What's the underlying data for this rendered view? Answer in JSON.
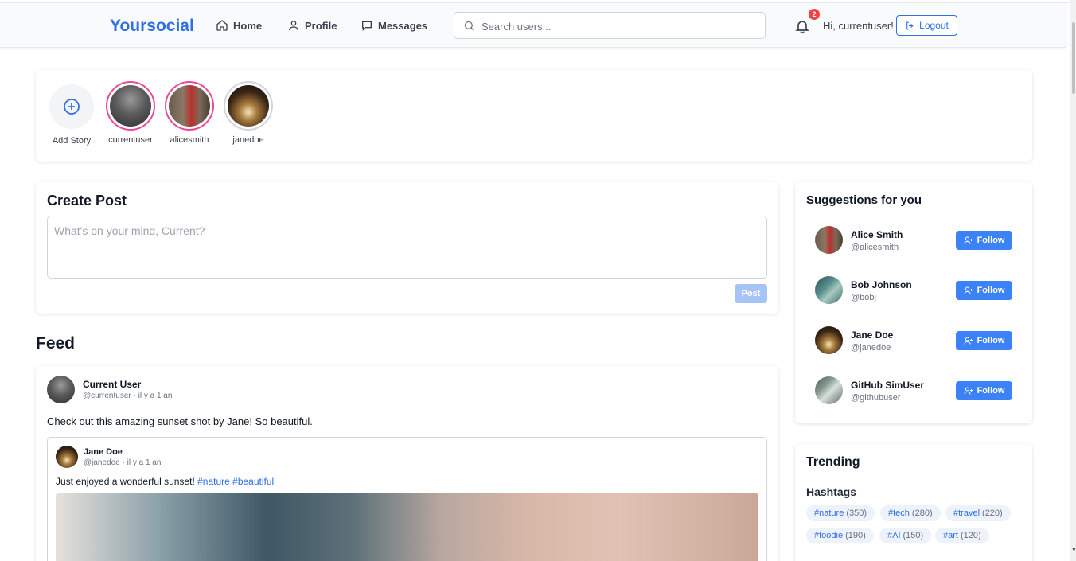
{
  "nav": {
    "brand": "Yoursocial",
    "home": "Home",
    "profile": "Profile",
    "messages": "Messages",
    "search_placeholder": "Search users...",
    "notification_count": "2",
    "greeting": "Hi, currentuser!",
    "logout": "Logout"
  },
  "stories": {
    "add_label": "Add Story",
    "items": [
      {
        "label": "currentuser"
      },
      {
        "label": "alicesmith"
      },
      {
        "label": "janedoe"
      }
    ]
  },
  "create_post": {
    "title": "Create Post",
    "placeholder": "What's on your mind, Current?",
    "button": "Post"
  },
  "feed": {
    "title": "Feed",
    "post": {
      "author": "Current User",
      "meta": "@currentuser · il y a 1 an",
      "text": "Check out this amazing sunset shot by Jane! So beautiful.",
      "shared": {
        "author": "Jane Doe",
        "meta": "@janedoe · il y a 1 an",
        "text": "Just enjoyed a wonderful sunset!",
        "hashtags": "#nature #beautiful"
      }
    }
  },
  "suggestions": {
    "title": "Suggestions for you",
    "follow_label": "Follow",
    "users": [
      {
        "name": "Alice Smith",
        "handle": "@alicesmith"
      },
      {
        "name": "Bob Johnson",
        "handle": "@bobj"
      },
      {
        "name": "Jane Doe",
        "handle": "@janedoe"
      },
      {
        "name": "GitHub SimUser",
        "handle": "@githubuser"
      }
    ]
  },
  "trending": {
    "title": "Trending",
    "subtitle": "Hashtags",
    "tags": [
      {
        "tag": "#nature",
        "count": "(350)"
      },
      {
        "tag": "#tech",
        "count": "(280)"
      },
      {
        "tag": "#travel",
        "count": "(220)"
      },
      {
        "tag": "#foodie",
        "count": "(190)"
      },
      {
        "tag": "#AI",
        "count": "(150)"
      },
      {
        "tag": "#art",
        "count": "(120)"
      }
    ]
  },
  "colors": {
    "brand": "#2f6fe4",
    "follow": "#3b82f6",
    "story_ring": "#ec4899",
    "badge": "#ef4444"
  }
}
